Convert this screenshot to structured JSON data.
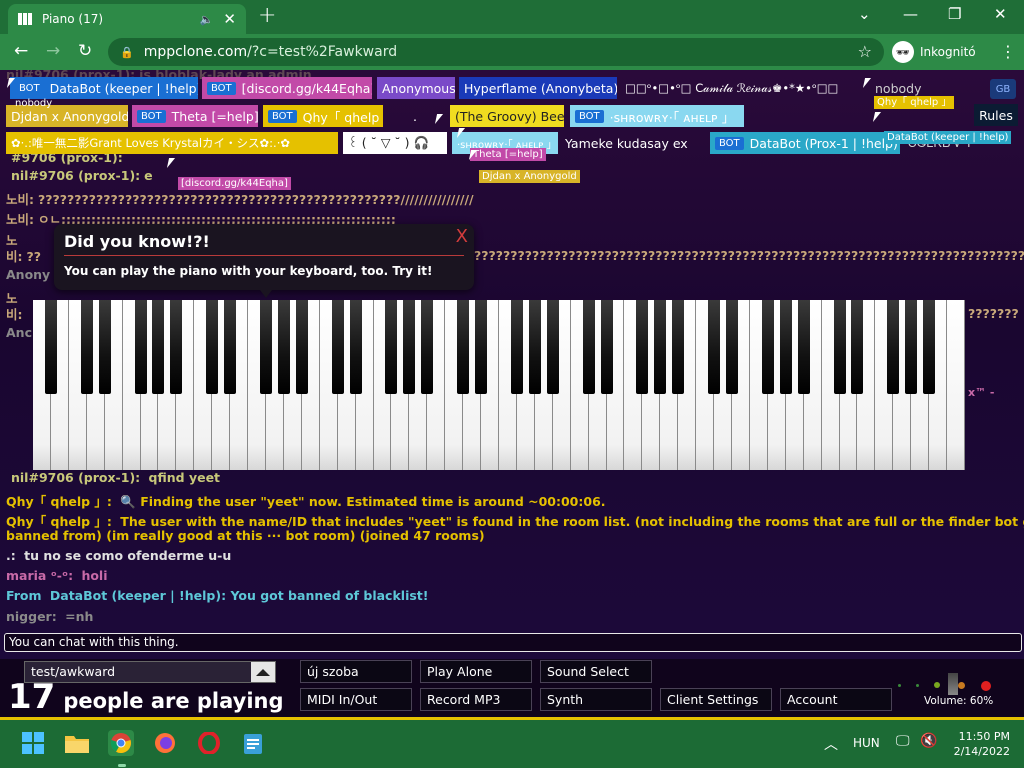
{
  "browser": {
    "tab_title": "Piano (17)",
    "tab_audio_icon": "speaker-icon",
    "tab_close": "✕",
    "new_tab": "+",
    "window_controls": [
      "⌄",
      "—",
      "❐",
      "✕"
    ],
    "url_host": "mppclone.com",
    "url_path": "/?c=test%2Fawkward",
    "incognito_label": "Inkognitó"
  },
  "chat": {
    "lines": [
      {
        "nick": "nil#9706 (prox-1):",
        "text": "is bloblak-lady an admin",
        "color": "#8a7a6a",
        "faint": true
      },
      {
        "nick": "#9706 (prox-1):",
        "text": "",
        "color": "#c8c87a"
      },
      {
        "nick": "nil#9706 (prox-1):",
        "text": "e",
        "color": "#c8c87a"
      },
      {
        "nick": "노비:",
        "text": "??????????????????????????????????????????????????////////////////",
        "color": "#c8a87a"
      },
      {
        "nick": "노비:",
        "text": "ㅇㄴ;;;;;;;;;;;;;;;;;;;;;;;;;;;;;;;;;;;;;;;;;;;;;;;;;;;;;;;;;;;;;;;;;;;",
        "color": "#c8a87a"
      },
      {
        "nick": "노",
        "text": "",
        "color": "#c8a87a"
      },
      {
        "nick": "비:",
        "text": "??",
        "color": "#c8a87a"
      },
      {
        "nick": "Anony",
        "text": "",
        "color": "#8a8a8a"
      },
      {
        "nick": "노",
        "text": "",
        "color": "#c8a87a"
      },
      {
        "nick": "비:",
        "text": "",
        "color": "#c8a87a"
      },
      {
        "nick": "Anc",
        "text": "",
        "color": "#8a8a8a"
      }
    ],
    "long_question_marks": "???????????????????????????????????????????????????????????????????????????????????????????????",
    "right_fragment": "???????",
    "tm_fragment": "x™ -",
    "recent": [
      {
        "nick": "nil#9706 (prox-1):",
        "text": "qfind yeet",
        "nick_color": "#c8c87a",
        "text_color": "#c8c87a"
      },
      {
        "nick": "Qhy「 qhelp 」:",
        "text": "🔍 Finding the user \"yeet\" now. Estimated time is around ~00:00:06.",
        "nick_color": "#e5c100",
        "text_color": "#e5c100"
      },
      {
        "nick": "Qhy「 qhelp 」:",
        "text": "The user with the name/ID that includes \"yeet\" is found in the room list. (not including the rooms that are full or the finder bot got",
        "nick_color": "#e5c100",
        "text_color": "#e5c100"
      },
      {
        "nick": "",
        "text": "banned from) (im really good at this ··· bot room) (joined 47 rooms)",
        "nick_color": "#e5c100",
        "text_color": "#e5c100"
      },
      {
        "nick": ".:",
        "text": "tu no se como ofenderme u-u",
        "nick_color": "#e0e0e0",
        "text_color": "#e0e0e0"
      },
      {
        "nick": "maria ᵒ-ᵒ:",
        "text": "holi",
        "nick_color": "#c86aa8",
        "text_color": "#c86aa8"
      },
      {
        "nick": "From",
        "text": "DataBot (keeper | !help):",
        "tail": "You got banned of blacklist!",
        "nick_color": "#5ec8d8",
        "text_color": "#5ec8d8"
      },
      {
        "nick": "nigger:",
        "text": "=nh",
        "nick_color": "#8a8a8a",
        "text_color": "#8a8a8a"
      }
    ],
    "input_placeholder": "You can chat with this thing."
  },
  "users": [
    {
      "name": "DataBot (keeper | !help)",
      "bot": true,
      "bg": "#1a6fd3"
    },
    {
      "name": "[discord.gg/k44Eqha]",
      "bot": true,
      "bg": "#c24aa8"
    },
    {
      "name": "Anonymous",
      "bot": false,
      "bg": "#7a4ac8"
    },
    {
      "name": "Hyperflame (Anonybeta)",
      "bot": false,
      "bg": "#1a3ab8"
    },
    {
      "name": "□□ᵒ•□•ᵒ□ C𝒶𝓂𝒾𝓁𝒶 ℛ𝑒𝒾𝓃𝒶𝓈♚•*★•ᵒ□□",
      "bot": false,
      "bg": "transparent"
    },
    {
      "name": "nobody",
      "bot": false,
      "bg": "transparent"
    },
    {
      "name": "Djdan x Anonygold",
      "bot": false,
      "bg": "#d8b428"
    },
    {
      "name": "Theta [=help]",
      "bot": true,
      "bg": "#c24aa8"
    },
    {
      "name": "Qhy「 qhelp 」",
      "bot": true,
      "bg": "#e5c100"
    },
    {
      "name": ".",
      "bot": false,
      "bg": "transparent"
    },
    {
      "name": "(The Groovy) Bee",
      "bot": false,
      "bg": "#f0dc20"
    },
    {
      "name": "·ꜱʜʀᴏᴡʀʏ·「 ᴀʜᴇʟᴘ 」",
      "bot": true,
      "bg": "#8ad8f0"
    },
    {
      "name": "✿·.:唯一無二影Grant Loves Krystalカイ・シス✿:.·✿",
      "bot": false,
      "bg": "#e5c100"
    },
    {
      "name": "꒰ ( ˘ ▽ ˘ ) 🎧",
      "bot": false,
      "bg": "#ffffff"
    },
    {
      "name": "·ꜱʜʀᴏᴡʀʏ·「 ᴀʜᴇʟᴘ 」",
      "bot": false,
      "bg": "#8ad8f0"
    },
    {
      "name": "Yameke kudasay ex",
      "bot": false,
      "bg": "transparent"
    },
    {
      "name": "DataBot (Prox-1 | !help)",
      "bot": true,
      "bg": "#2aa8c8"
    },
    {
      "name": "ᏟᏫᏞᏦᏴᏉᎢᎡ",
      "bot": false,
      "bg": "transparent"
    }
  ],
  "bot_tag": "BOT",
  "cursor_labels": [
    {
      "text": "nobody",
      "bg": "transparent",
      "color": "#ffffff"
    },
    {
      "text": "Qhy「 qhelp 」",
      "bg": "#e5c100",
      "color": "#ffffff"
    },
    {
      "text": "DataBot (keeper | !help)",
      "bg": "#2aa8c8",
      "color": "#ffffff"
    },
    {
      "text": "[discord.gg/k44Eqha]",
      "bg": "#c24aa8",
      "color": "#ffffff"
    },
    {
      "text": "Theta [=help]",
      "bg": "#c24aa8",
      "color": "#ffffff"
    },
    {
      "text": "Djdan x Anonygold",
      "bg": "#d8b428",
      "color": "#ffffff"
    },
    {
      "text": "nobody",
      "bg": "transparent",
      "color": "#cfcfcf"
    }
  ],
  "rules_label": "Rules",
  "gb_badge": "GB",
  "tooltip": {
    "title": "Did you know!?!",
    "text": "You can play the piano with your keyboard, too. Try it!",
    "close": "X"
  },
  "piano": {
    "white_keys": 52
  },
  "bottom": {
    "room": "test/awkward",
    "player_count": "17",
    "players_text": "people are playing",
    "buttons_row1": [
      "új szoba",
      "Play Alone",
      "Sound Select"
    ],
    "buttons_row2": [
      "MIDI In/Out",
      "Record MP3",
      "Synth",
      "Client Settings",
      "Account"
    ],
    "volume": "Volume: 60%"
  },
  "taskbar": {
    "apps": [
      "windows-start-icon",
      "file-explorer-icon",
      "chrome-icon",
      "firefox-icon",
      "opera-icon",
      "notepad-icon"
    ],
    "language": "HUN",
    "time": "11:50 PM",
    "date": "2/14/2022"
  }
}
